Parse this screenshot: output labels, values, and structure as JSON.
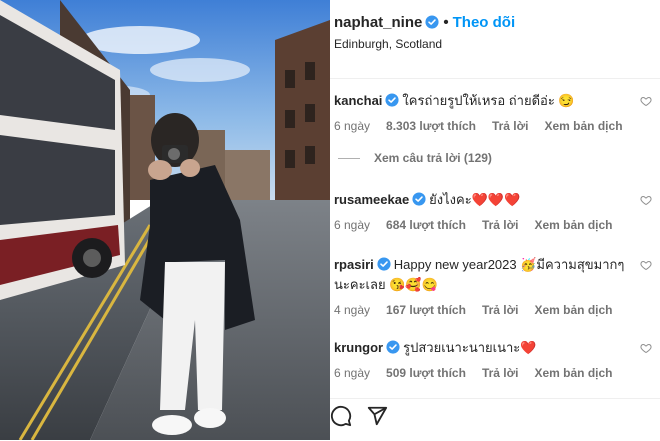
{
  "header": {
    "username": "naphat_nine",
    "follow_label": "Theo dõi",
    "location": "Edinburgh, Scotland"
  },
  "comments": [
    {
      "user": "kanchai",
      "verified": true,
      "text": "ใครถ่ายรูปให้เหรอ ถ่ายดีอ่ะ 😏",
      "age": "6 ngày",
      "likes": "8.303 lượt thích",
      "reply": "Trả lời",
      "translate": "Xem bản dịch"
    },
    {
      "user": "rusameekae",
      "verified": true,
      "text": "ยังไงคะ❤️❤️❤️",
      "age": "6 ngày",
      "likes": "684 lượt thích",
      "reply": "Trả lời",
      "translate": "Xem bản dịch"
    },
    {
      "user": "rpasiri",
      "verified": true,
      "text": "Happy new year2023 🥳มีความสุขมากๆนะคะเลย 😘🥰😋",
      "age": "4 ngày",
      "likes": "167 lượt thích",
      "reply": "Trả lời",
      "translate": "Xem bản dịch"
    },
    {
      "user": "krungor",
      "verified": true,
      "text": "รูปสวยเนาะนายเนาะ❤️",
      "age": "6 ngày",
      "likes": "509 lượt thích",
      "reply": "Trả lời",
      "translate": "Xem bản dịch"
    }
  ],
  "view_replies": "Xem câu trả lời (129)",
  "actions": {
    "comment_icon": "comment-icon",
    "share_icon": "share-icon"
  },
  "colors": {
    "accent": "#0095f6",
    "verified": "#3897f0",
    "muted": "#737373",
    "text": "#262626"
  }
}
